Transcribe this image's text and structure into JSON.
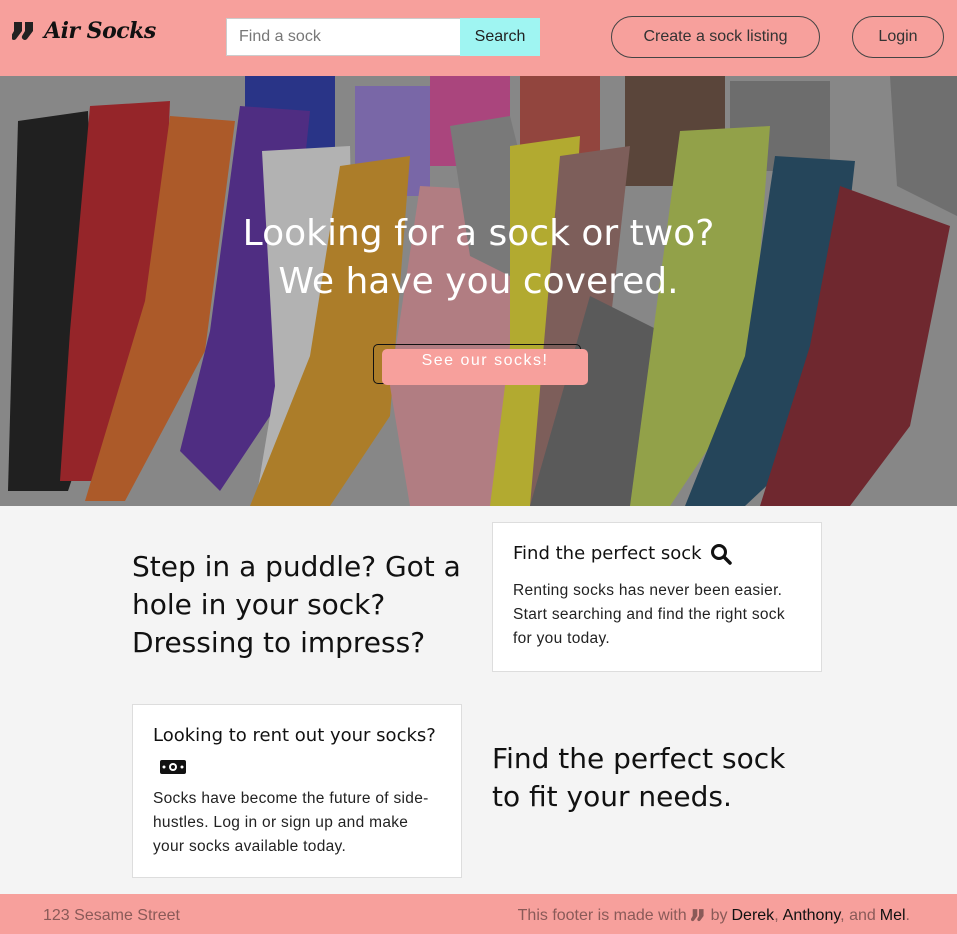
{
  "brand": {
    "name": "Air Socks",
    "icon": "socks-icon"
  },
  "header": {
    "search_placeholder": "Find a sock",
    "search_button": "Search",
    "create_button": "Create a sock listing",
    "login_button": "Login"
  },
  "hero": {
    "title_line1": "Looking for a sock or two?",
    "title_line2": "We have you covered.",
    "cta": "See our socks!"
  },
  "sections": {
    "tagline1": "Step in a puddle? Got a hole in your sock? Dressing to impress?",
    "tagline2": "Find the perfect sock to fit your needs.",
    "card1": {
      "title": "Find the perfect sock",
      "icon": "search-icon",
      "text": "Renting socks has never been easier. Start searching and find the right sock for you today."
    },
    "card2": {
      "title": "Looking to rent out your socks?",
      "icon": "money-icon",
      "text": "Socks have become the future of side-hustles. Log in or sign up and make your socks available today."
    }
  },
  "footer": {
    "address": "123 Sesame Street",
    "credits_prefix": "This footer is made with",
    "credits_by": "by",
    "authors": [
      "Derek",
      "Anthony",
      "Mel"
    ],
    "sep1": ",",
    "sep2": ", and",
    "end": "."
  },
  "colors": {
    "brand_pink": "#f7a09c",
    "search_cyan": "#9ff5f2"
  }
}
